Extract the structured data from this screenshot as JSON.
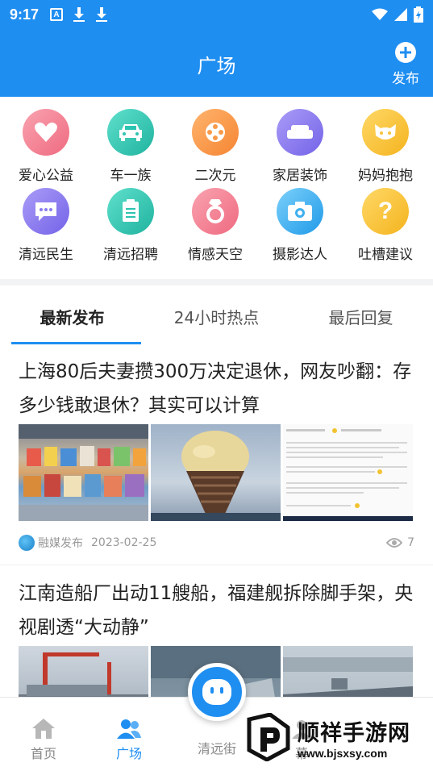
{
  "status_bar": {
    "time": "9:17"
  },
  "app_bar": {
    "title": "广场",
    "publish_label": "发布"
  },
  "categories": [
    {
      "label": "爱心公益",
      "icon": "heart-icon",
      "color": "#f47a8c"
    },
    {
      "label": "车一族",
      "icon": "car-icon",
      "color": "#2cc4b0"
    },
    {
      "label": "二次元",
      "icon": "film-reel-icon",
      "color": "#f99a4a"
    },
    {
      "label": "家居装饰",
      "icon": "sofa-icon",
      "color": "#8a7cf0"
    },
    {
      "label": "妈妈抱抱",
      "icon": "cat-face-icon",
      "color": "#f7c23a"
    },
    {
      "label": "清远民生",
      "icon": "chat-bubble-icon",
      "color": "#8a7cf0"
    },
    {
      "label": "清远招聘",
      "icon": "clipboard-icon",
      "color": "#2cc4b0"
    },
    {
      "label": "情感天空",
      "icon": "ring-icon",
      "color": "#f47a8c"
    },
    {
      "label": "摄影达人",
      "icon": "camera-icon",
      "color": "#3fb0ee"
    },
    {
      "label": "吐槽建议",
      "icon": "question-icon",
      "color": "#f7c23a"
    }
  ],
  "tabs": [
    {
      "label": "最新发布",
      "active": true
    },
    {
      "label": "24小时热点",
      "active": false
    },
    {
      "label": "最后回复",
      "active": false
    }
  ],
  "articles": [
    {
      "title": "上海80后夫妻攒300万决定退休，网友吵翻：存多少钱敢退休？其实可以计算",
      "source": "融媒发布",
      "date": "2023-02-25",
      "views": "7"
    },
    {
      "title": "江南造船厂出动11艘船，福建舰拆除脚手架，央视剧透“大动静”"
    }
  ],
  "bottom_nav": [
    {
      "label": "首页",
      "icon": "home-icon",
      "active": false
    },
    {
      "label": "广场",
      "icon": "people-icon",
      "active": true
    },
    {
      "label": "清远街",
      "icon": "robot-face-icon",
      "active": false
    },
    {
      "label": "幕",
      "icon": "user-icon",
      "active": false
    }
  ],
  "watermark": {
    "name": "顺祥手游网",
    "url": "www.bjsxsy.com"
  },
  "colors": {
    "primary": "#1f8ef1",
    "active_tab": "#1f8ef1"
  }
}
